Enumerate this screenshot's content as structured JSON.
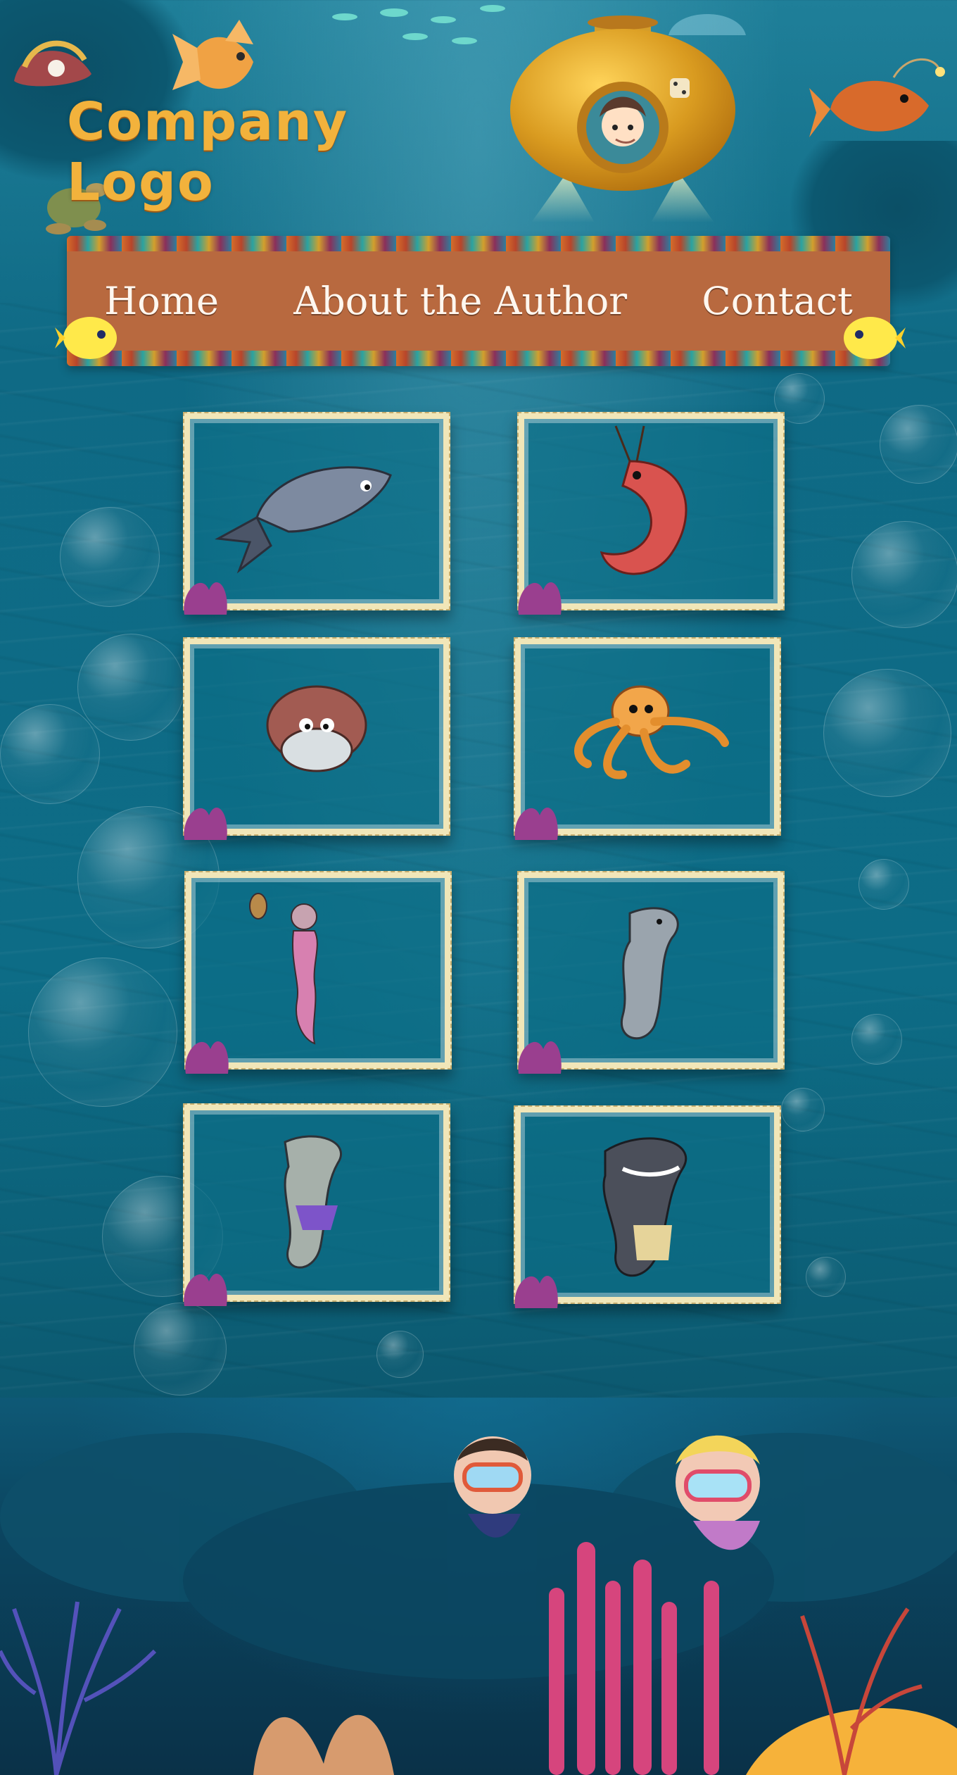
{
  "logo": {
    "text": "Company Logo"
  },
  "nav": {
    "items": [
      {
        "label": "Home"
      },
      {
        "label": "About the Author"
      },
      {
        "label": "Contact"
      }
    ]
  },
  "gallery": {
    "items": [
      {
        "character": "fish"
      },
      {
        "character": "shrimp"
      },
      {
        "character": "turtle"
      },
      {
        "character": "octopus"
      },
      {
        "character": "mermaid"
      },
      {
        "character": "dolphin"
      },
      {
        "character": "dolphin-skirt"
      },
      {
        "character": "shark"
      }
    ]
  },
  "colors": {
    "logo": "#f2b23c",
    "nav_bar": "#b8693f",
    "nav_text": "#fff7ef",
    "frame_border": "#f1e6b8",
    "water": "#0d6c86"
  }
}
